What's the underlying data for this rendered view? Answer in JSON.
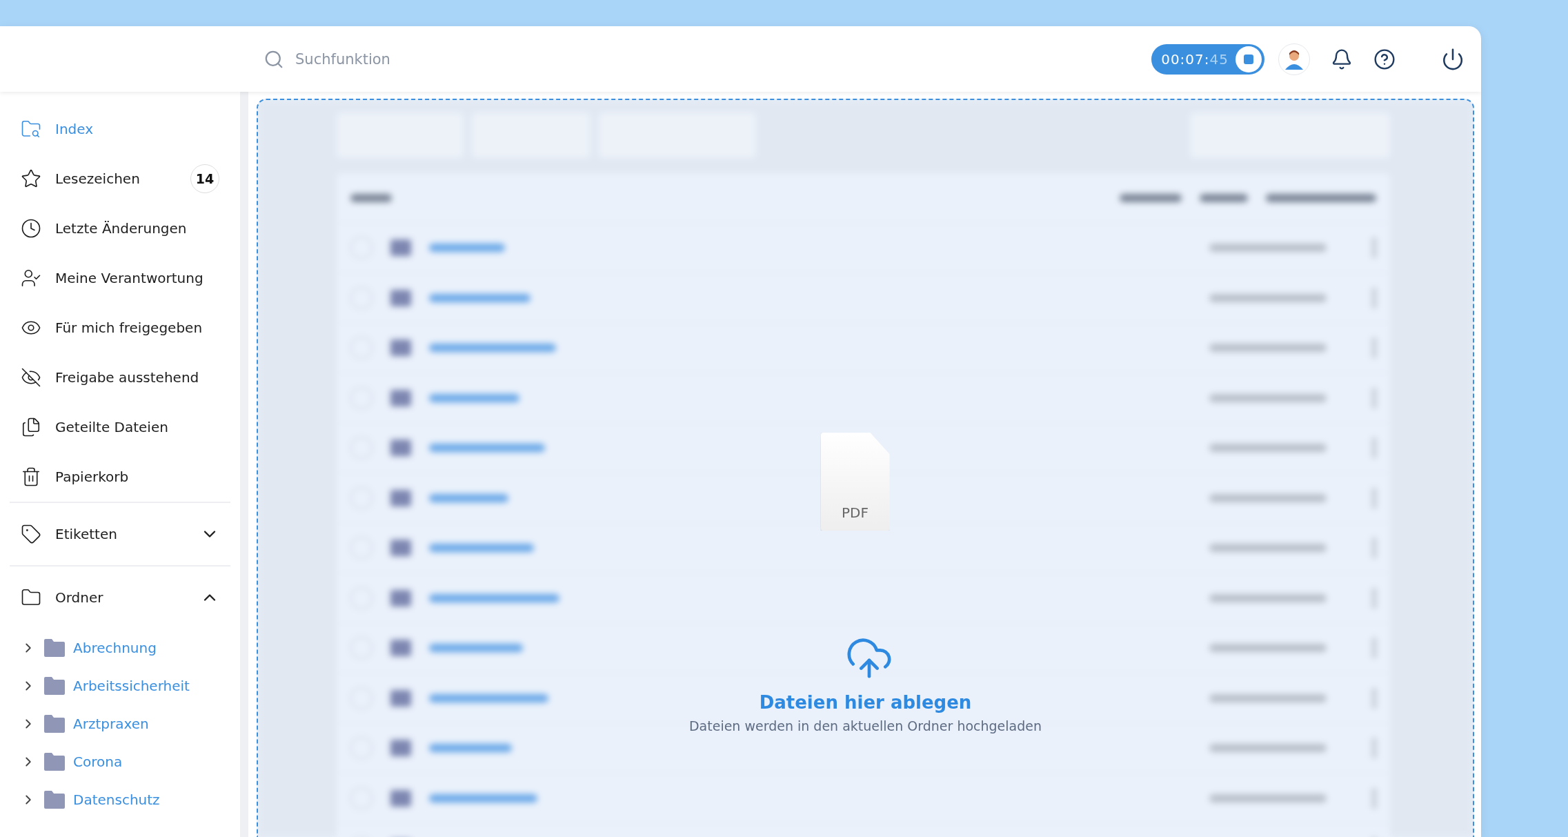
{
  "topbar": {
    "search": {
      "placeholder": "Suchfunktion"
    },
    "timer": {
      "main": "00:07:",
      "seconds": "45",
      "running": true
    }
  },
  "sidebar": {
    "items": [
      {
        "label": "Index",
        "selected": true
      },
      {
        "label": "Lesezeichen",
        "selected": false,
        "badge": "14"
      },
      {
        "label": "Letzte Änderungen",
        "selected": false
      },
      {
        "label": "Meine Verantwortung",
        "selected": false
      },
      {
        "label": "Für mich freigegeben",
        "selected": false
      },
      {
        "label": "Freigabe ausstehend",
        "selected": false
      },
      {
        "label": "Geteilte Dateien",
        "selected": false
      },
      {
        "label": "Papierkorb",
        "selected": false
      }
    ],
    "sections": [
      {
        "label": "Etiketten",
        "expanded": false
      },
      {
        "label": "Ordner",
        "expanded": true,
        "children": [
          {
            "label": "Abrechnung"
          },
          {
            "label": "Arbeitssicherheit"
          },
          {
            "label": "Arztpraxen"
          },
          {
            "label": "Corona"
          },
          {
            "label": "Datenschutz"
          }
        ]
      }
    ]
  },
  "dropzone": {
    "backdrop": {
      "kind": "blurred-table"
    },
    "file_label": "PDF",
    "title": "Dateien hier ablegen",
    "subtitle": "Dateien werden in den aktuellen Ordner hochgeladen"
  }
}
